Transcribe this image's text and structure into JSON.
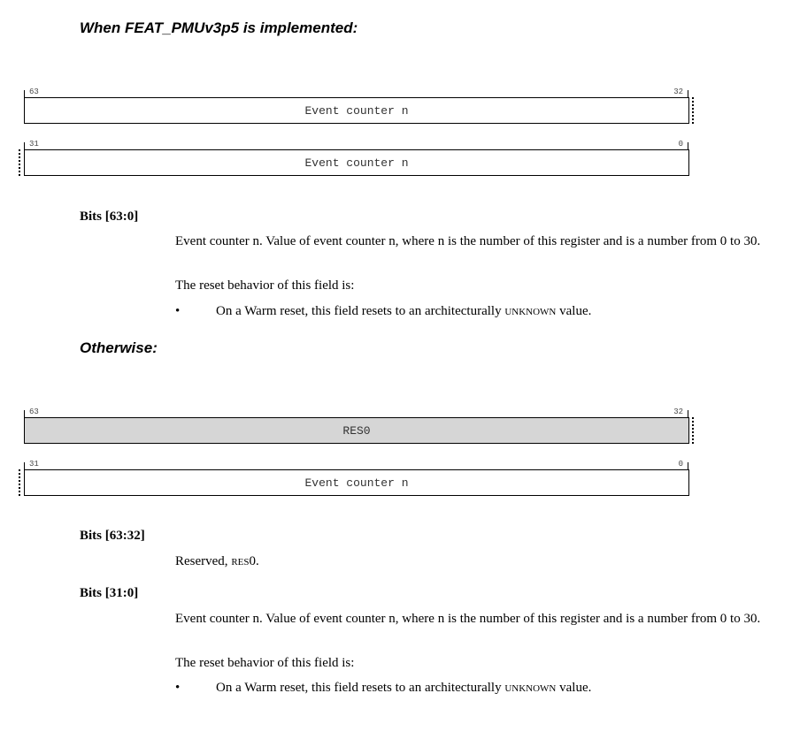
{
  "section1": {
    "heading": "When FEAT_PMUv3p5 is implemented:",
    "upper": {
      "bit_hi": "63",
      "bit_lo": "32",
      "field": "Event counter n"
    },
    "lower": {
      "bit_hi": "31",
      "bit_lo": "0",
      "field": "Event counter n"
    },
    "field_desc": {
      "title": "Bits [63:0]",
      "para1": "Event counter n. Value of event counter n, where n is the number of this register and is a number from 0 to 30.",
      "para2": "The reset behavior of this field is:",
      "bullet_symbol": "•",
      "bullet_prefix": "On a Warm reset, this field resets to an architecturally ",
      "bullet_sc": "UNKNOWN",
      "bullet_suffix": " value."
    }
  },
  "section2": {
    "heading": "Otherwise:",
    "upper": {
      "bit_hi": "63",
      "bit_lo": "32",
      "field": "RES0"
    },
    "lower": {
      "bit_hi": "31",
      "bit_lo": "0",
      "field": "Event counter n"
    },
    "field1": {
      "title": "Bits [63:32]",
      "text_prefix": "Reserved, ",
      "text_sc": "RES",
      "text_suffix": "0."
    },
    "field2": {
      "title": "Bits [31:0]",
      "para1": "Event counter n. Value of event counter n, where n is the number of this register and is a number from 0 to 30.",
      "para2": "The reset behavior of this field is:",
      "bullet_symbol": "•",
      "bullet_prefix": "On a Warm reset, this field resets to an architecturally ",
      "bullet_sc": "UNKNOWN",
      "bullet_suffix": " value."
    }
  },
  "colors": {
    "res0_fill": "#d6d6d6",
    "border": "#000000",
    "text": "#000000"
  }
}
